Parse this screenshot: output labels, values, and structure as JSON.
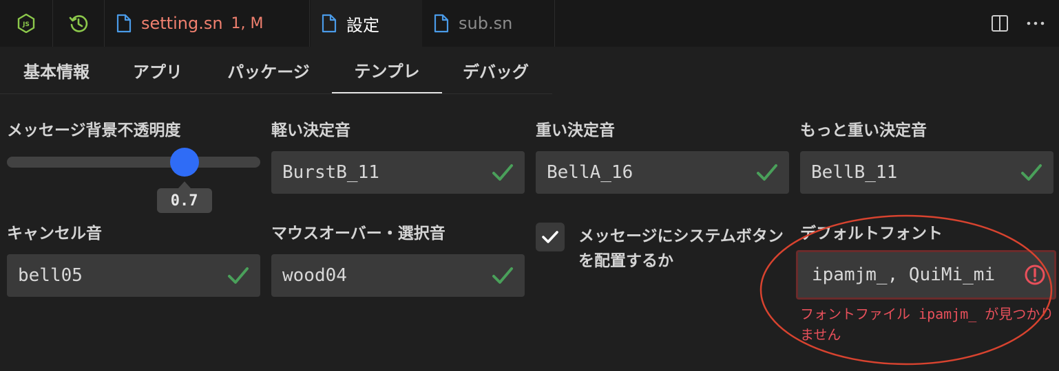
{
  "tabs": [
    {
      "icon": "nodejs-icon"
    },
    {
      "icon": "history-icon"
    },
    {
      "icon": "file-icon",
      "label": "setting.sn",
      "badge": "1, M"
    },
    {
      "icon": "file-icon",
      "label": "設定"
    },
    {
      "icon": "file-icon",
      "label": "sub.sn"
    }
  ],
  "editor_actions": {
    "split": "split-editor-icon",
    "more": "more-actions-icon"
  },
  "subtabs": [
    "基本情報",
    "アプリ",
    "パッケージ",
    "テンプレ",
    "デバッグ"
  ],
  "active_subtab": "テンプレ",
  "settings": {
    "opacity": {
      "label": "メッセージ背景不透明度",
      "value": "0.7",
      "level": 0.7
    },
    "light_decide": {
      "label": "軽い決定音",
      "value": "BurstB_11"
    },
    "heavy_decide": {
      "label": "重い決定音",
      "value": "BellA_16"
    },
    "heavier_decide": {
      "label": "もっと重い決定音",
      "value": "BellB_11"
    },
    "cancel": {
      "label": "キャンセル音",
      "value": "bell05"
    },
    "mouseover": {
      "label": "マウスオーバー・選択音",
      "value": "wood04"
    },
    "system_buttons": {
      "label": "メッセージにシステムボタンを配置するか",
      "checked": true
    },
    "default_font": {
      "label": "デフォルトフォント",
      "value": "ipamjm_, QuiMi_mi",
      "error": "フォントファイル ipamjm_ が見つかりません"
    }
  },
  "colors": {
    "valid_check": "#4aa05a",
    "error": "#e8505b",
    "accent": "#2f6cf6",
    "annotation": "#d8432f"
  }
}
